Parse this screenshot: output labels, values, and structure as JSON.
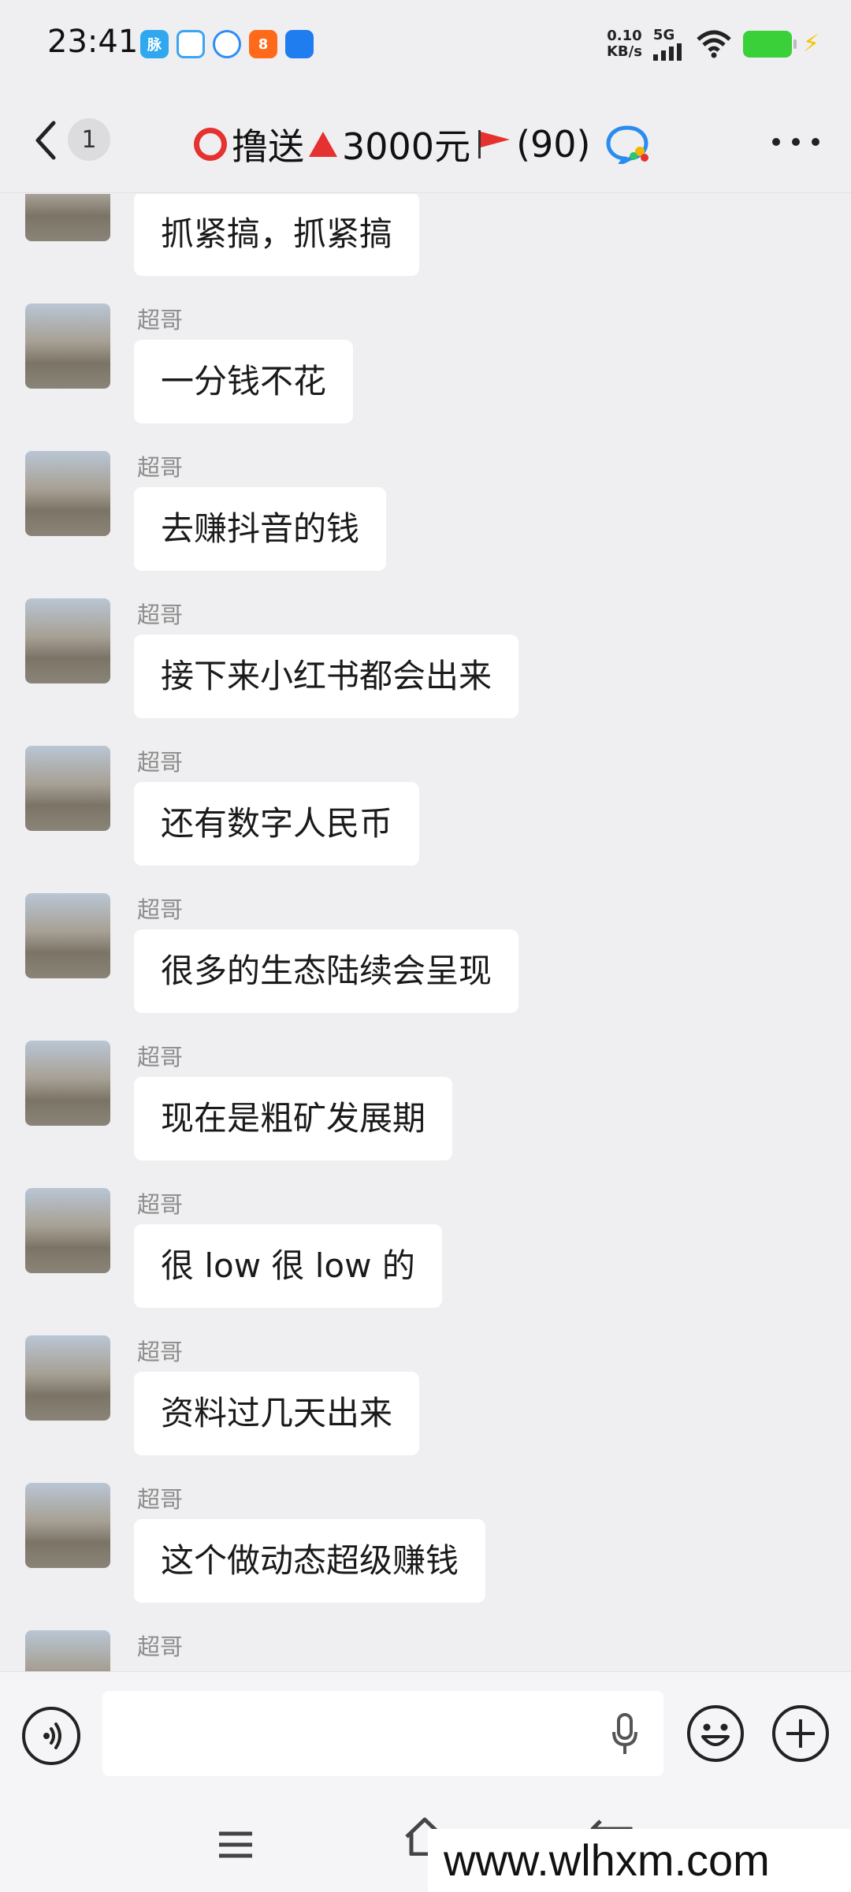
{
  "status_bar": {
    "time": "23:41",
    "net_speed_value": "0.10",
    "net_speed_unit": "KB/s",
    "network_type": "5G",
    "app_icons": [
      "app-blue-icon",
      "app-qq-chat-icon",
      "app-qq-browser-icon",
      "app-orange-icon",
      "app-blue-window-icon"
    ],
    "battery_color": "#3ad03a"
  },
  "header": {
    "back_badge": "1",
    "title_text_1": "撸送",
    "title_text_2": "3000元",
    "title_count": "(90)",
    "accent_red": "#e5312f"
  },
  "messages": [
    {
      "sender": "超哥",
      "text": "抓紧搞，抓紧搞"
    },
    {
      "sender": "超哥",
      "text": "一分钱不花"
    },
    {
      "sender": "超哥",
      "text": "去赚抖音的钱"
    },
    {
      "sender": "超哥",
      "text": "接下来小红书都会出来"
    },
    {
      "sender": "超哥",
      "text": "还有数字人民币"
    },
    {
      "sender": "超哥",
      "text": "很多的生态陆续会呈现"
    },
    {
      "sender": "超哥",
      "text": "现在是粗矿发展期"
    },
    {
      "sender": "超哥",
      "text": "很 low 很 low 的"
    },
    {
      "sender": "超哥",
      "text": "资料过几天出来"
    },
    {
      "sender": "超哥",
      "text": "这个做动态超级赚钱"
    },
    {
      "sender": "超哥",
      "text": ""
    }
  ],
  "input": {
    "value": "",
    "placeholder": ""
  },
  "watermark": "www.wlhxm.com"
}
